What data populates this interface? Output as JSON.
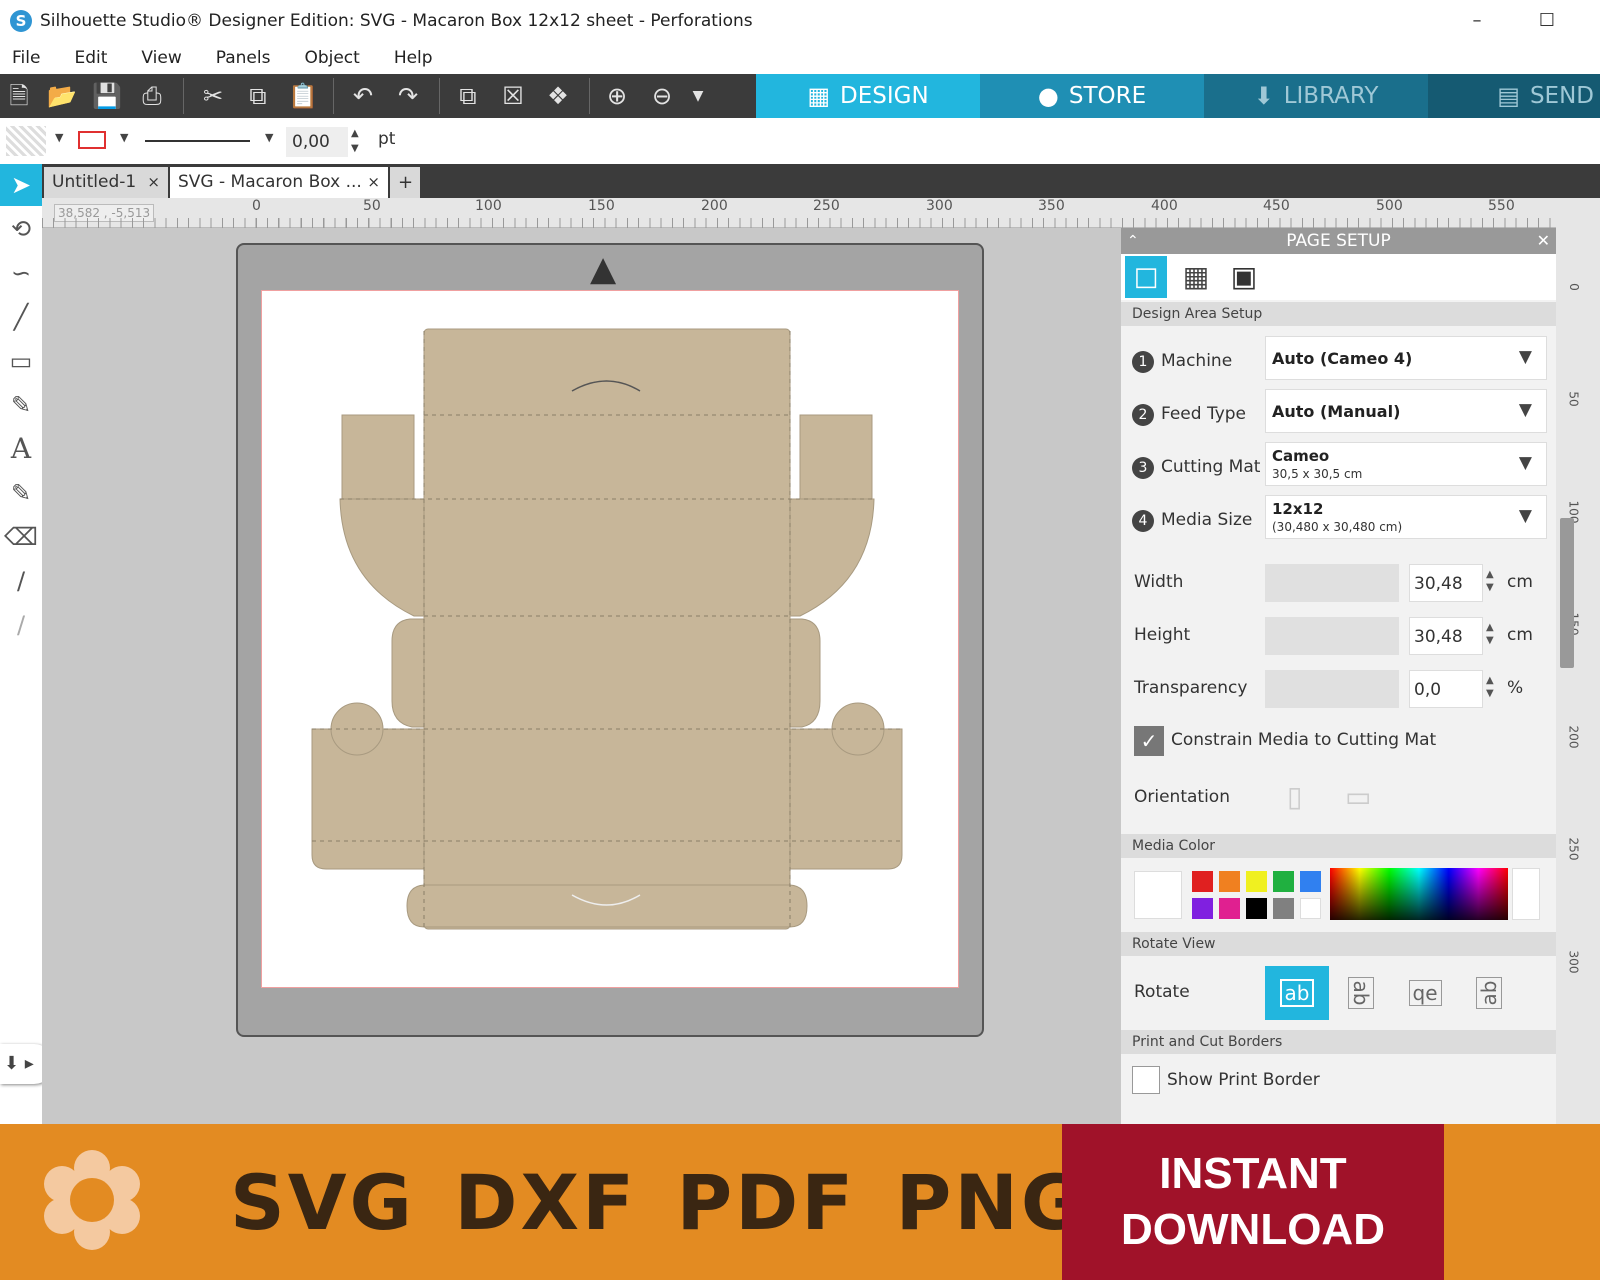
{
  "window": {
    "title": "Silhouette Studio® Designer Edition: SVG - Macaron Box 12x12 sheet - Perforations",
    "minimize": "–",
    "maximize": "☐"
  },
  "menu": [
    "File",
    "Edit",
    "View",
    "Panels",
    "Object",
    "Help"
  ],
  "nav_tabs": {
    "design": "DESIGN",
    "store": "STORE",
    "library": "LIBRARY",
    "send": "SEND"
  },
  "line_width": {
    "value": "0,00",
    "unit": "pt"
  },
  "doc_tabs": [
    {
      "label": "Untitled-1",
      "close": "×"
    },
    {
      "label": "SVG - Macaron Box ...",
      "close": "×"
    }
  ],
  "add_tab": "+",
  "coordinates": "38,582 , -5,513",
  "ruler": {
    "h_ticks": [
      "0",
      "50",
      "100",
      "150",
      "200",
      "250",
      "300",
      "350",
      "400",
      "450",
      "500",
      "550"
    ],
    "v_ticks": [
      "0",
      "50",
      "100",
      "150",
      "200",
      "250",
      "300"
    ]
  },
  "panel": {
    "title": "PAGE SETUP",
    "design_area_section": "Design Area Setup",
    "machine_label": "Machine",
    "machine_value": "Auto (Cameo 4)",
    "feed_label": "Feed Type",
    "feed_value": "Auto (Manual)",
    "mat_label": "Cutting Mat",
    "mat_value": "Cameo",
    "mat_sub": "30,5 x 30,5 cm",
    "media_label": "Media Size",
    "media_value": "12x12",
    "media_sub": "(30,480 x 30,480 cm)",
    "width_label": "Width",
    "width_value": "30,48",
    "width_unit": "cm",
    "height_label": "Height",
    "height_value": "30,48",
    "height_unit": "cm",
    "transparency_label": "Transparency",
    "transparency_value": "0,0",
    "transparency_unit": "%",
    "constrain_label": "Constrain Media to Cutting Mat",
    "constrain_checked": true,
    "orientation_label": "Orientation",
    "media_color_section": "Media Color",
    "swatches": [
      "#e02020",
      "#f08020",
      "#f0f020",
      "#20b040",
      "#3080f0",
      "#8020e0",
      "#e02090",
      "#000000",
      "#808080",
      "#ffffff"
    ],
    "rotate_view_section": "Rotate View",
    "rotate_label": "Rotate",
    "rotate_options": [
      "ab",
      "ab",
      "qe",
      "ab"
    ],
    "borders_section": "Print and Cut Borders",
    "show_print_border": "Show Print Border"
  },
  "banner": {
    "formats": "SVG DXF PDF PNG",
    "cta_line1": "INSTANT",
    "cta_line2": "DOWNLOAD"
  }
}
